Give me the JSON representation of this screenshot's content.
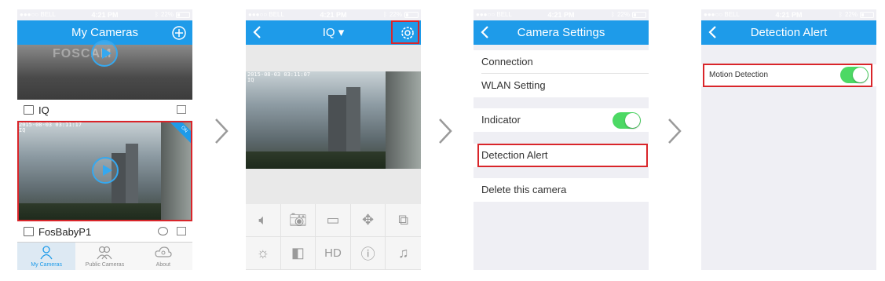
{
  "status": {
    "carrier": "●●●○○ BELL",
    "time": "4:21 PM",
    "battery": "22%"
  },
  "panel1": {
    "title": "My Cameras",
    "watermark": "FOSCAM",
    "cameras": [
      {
        "name": "IQ"
      },
      {
        "name": "FosBabyP1",
        "timestamp": "2015-08-03 03:11:17\nIQ",
        "badge": "ON"
      }
    ],
    "tabs": [
      {
        "label": "My Cameras"
      },
      {
        "label": "Public Cameras"
      },
      {
        "label": "About"
      }
    ]
  },
  "panel2": {
    "title": "IQ ▾",
    "timestamp": "2015-08-03 03:11:07\nIQ",
    "controls_row2": {
      "hd": "HD"
    }
  },
  "panel3": {
    "title": "Camera Settings",
    "rows": {
      "connection": "Connection",
      "wlan": "WLAN Setting",
      "indicator": "Indicator",
      "detection": "Detection Alert",
      "delete": "Delete this camera"
    }
  },
  "panel4": {
    "title": "Detection Alert",
    "motion": "Motion Detection"
  },
  "colors": {
    "accent": "#1e9be9",
    "highlight": "#d9252a",
    "toggle_on": "#4cd964"
  }
}
